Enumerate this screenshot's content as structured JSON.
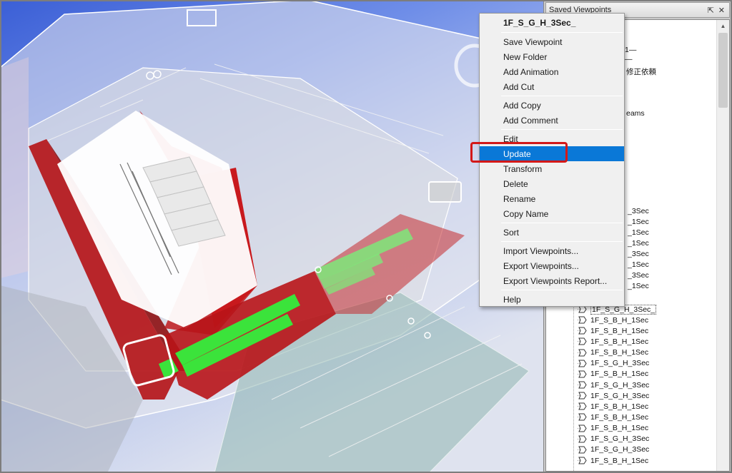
{
  "panel": {
    "title": "Saved Viewpoints",
    "pin_icon": "pin-icon",
    "close_icon": "close-icon",
    "partially_visible": [
      "1—",
      "—",
      "修正依頼",
      "eams",
      "_3Sec",
      "_1Sec",
      "_1Sec",
      "_1Sec",
      "_3Sec",
      "_1Sec",
      "_3Sec",
      "_1Sec"
    ],
    "items": [
      {
        "label": "1F_S_G_H_3Sec_",
        "selected": true
      },
      {
        "label": "1F_S_B_H_1Sec"
      },
      {
        "label": "1F_S_B_H_1Sec"
      },
      {
        "label": "1F_S_B_H_1Sec"
      },
      {
        "label": "1F_S_B_H_1Sec"
      },
      {
        "label": "1F_S_G_H_3Sec"
      },
      {
        "label": "1F_S_B_H_1Sec"
      },
      {
        "label": "1F_S_G_H_3Sec"
      },
      {
        "label": "1F_S_G_H_3Sec"
      },
      {
        "label": "1F_S_B_H_1Sec"
      },
      {
        "label": "1F_S_B_H_1Sec"
      },
      {
        "label": "1F_S_B_H_1Sec"
      },
      {
        "label": "1F_S_G_H_3Sec"
      },
      {
        "label": "1F_S_G_H_3Sec"
      },
      {
        "label": "1F_S_B_H_1Sec"
      }
    ]
  },
  "context_menu": {
    "header": "1F_S_G_H_3Sec_",
    "groups": [
      [
        "Save Viewpoint",
        "New Folder",
        "Add Animation",
        "Add Cut"
      ],
      [
        "Add Copy",
        "Add Comment"
      ],
      [
        "Edit",
        "Update",
        "Transform",
        "Delete",
        "Rename",
        "Copy Name"
      ],
      [
        "Sort"
      ],
      [
        "Import Viewpoints...",
        "Export Viewpoints...",
        "Export Viewpoints Report..."
      ],
      [
        "Help"
      ]
    ],
    "highlighted": "Update"
  },
  "colors": {
    "highlight": "#0a78d7",
    "callout": "#d31818",
    "wall_red": "#b5161a",
    "beam_green": "#3be33b"
  },
  "icons": {
    "viewpoint": "camera-icon",
    "viewcube": "viewcube-icon"
  }
}
